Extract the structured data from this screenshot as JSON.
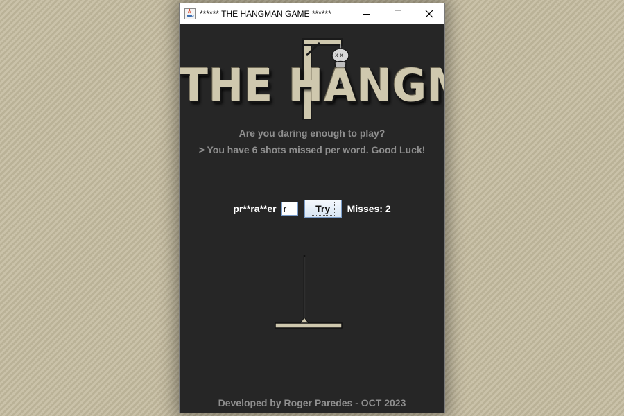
{
  "window": {
    "title": "****** THE HANGMAN GAME ******"
  },
  "icons": {
    "app": "java-cup-icon",
    "minimize": "minimize-icon",
    "maximize": "maximize-icon",
    "close": "close-icon"
  },
  "logo": {
    "text": "THE HANGMAN"
  },
  "intro": {
    "line1": "Are you daring enough to play?",
    "line2": "> You have 6 shots missed per word. Good Luck!"
  },
  "game": {
    "masked_word": "pr**ra**er",
    "letter_value": "r",
    "try_label": "Try",
    "misses_label": "Misses: 2",
    "misses": 2,
    "max_misses": 6
  },
  "footer": {
    "credit": "Developed by Roger Paredes - OCT 2023"
  },
  "colors": {
    "window_bg": "#262626",
    "muted_text": "#8f8f8f",
    "logo_text": "#cfc8ae",
    "desktop_bg": "#c4bb9f"
  }
}
